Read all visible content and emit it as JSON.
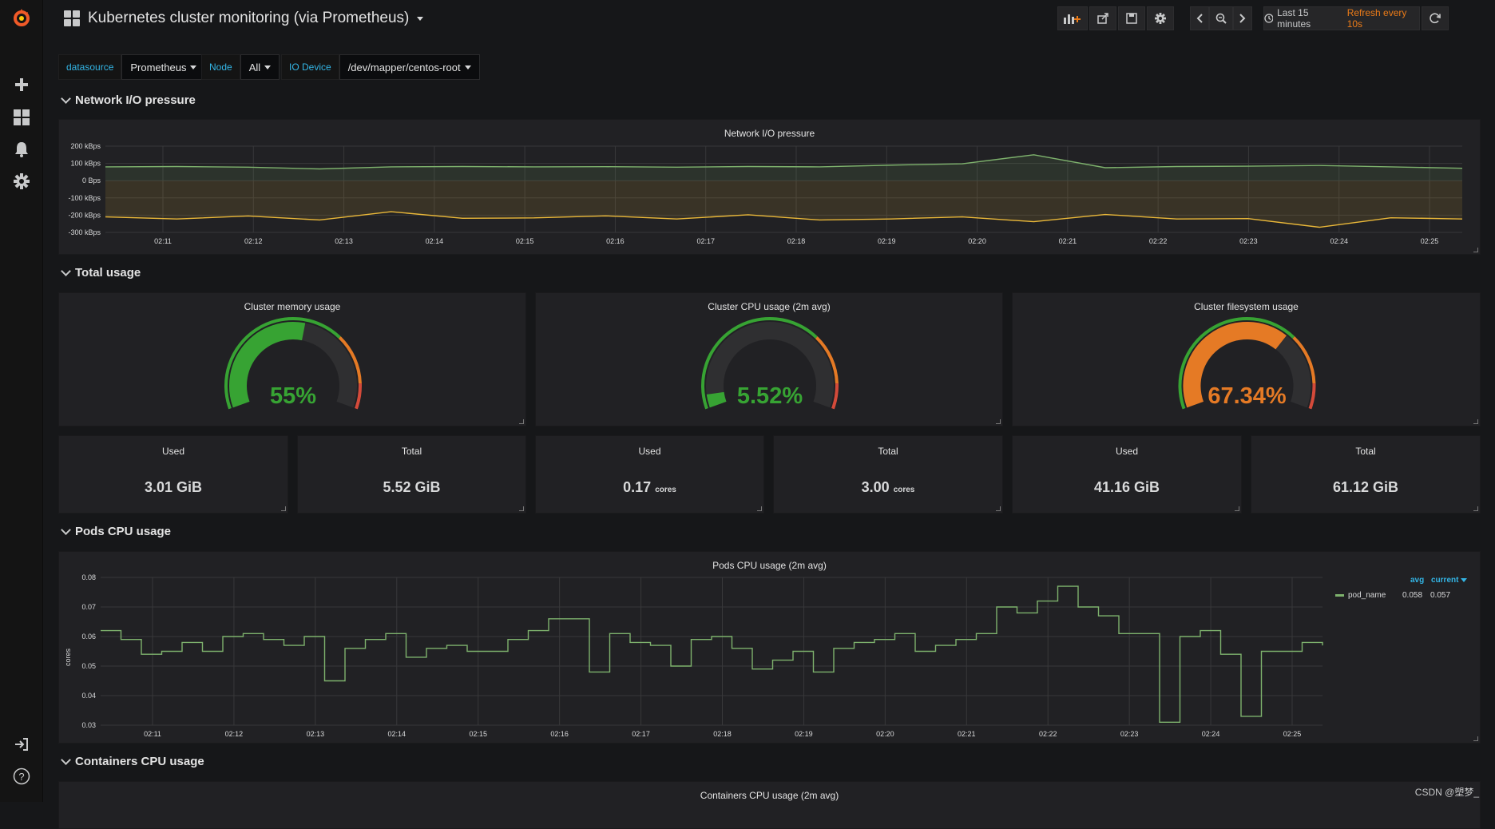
{
  "dashboard": {
    "title": "Kubernetes cluster monitoring (via Prometheus)"
  },
  "toolbar": {
    "time_range": "Last 15 minutes",
    "refresh": "Refresh every 10s",
    "icons": [
      "add-panel-icon",
      "share-icon",
      "save-icon",
      "settings-icon",
      "time-back-icon",
      "zoom-out-icon",
      "time-forward-icon",
      "clock-icon",
      "refresh-icon"
    ]
  },
  "sidebar": {
    "icons": [
      "grafana-logo-icon",
      "plus-icon",
      "dashboards-icon",
      "alerting-bell-icon",
      "configuration-gear-icon",
      "sign-in-icon",
      "help-icon"
    ]
  },
  "variables": [
    {
      "label": "datasource",
      "value": "Prometheus"
    },
    {
      "label": "Node",
      "value": "All"
    },
    {
      "label": "IO Device",
      "value": "/dev/mapper/centos-root"
    }
  ],
  "rows": {
    "network": "Network I/O pressure",
    "total": "Total usage",
    "pods": "Pods CPU usage",
    "containers": "Containers CPU usage"
  },
  "network_panel": {
    "title": "Network I/O pressure"
  },
  "gauges": [
    {
      "title": "Cluster memory usage",
      "value": 55,
      "display": "55%",
      "color": "#37a333"
    },
    {
      "title": "Cluster CPU usage (2m avg)",
      "value": 5.52,
      "display": "5.52%",
      "color": "#37a333"
    },
    {
      "title": "Cluster filesystem usage",
      "value": 67.34,
      "display": "67.34%",
      "color": "#e57a25"
    }
  ],
  "stats": [
    {
      "label": "Used",
      "value": "3.01 GiB",
      "unit": ""
    },
    {
      "label": "Total",
      "value": "5.52 GiB",
      "unit": ""
    },
    {
      "label": "Used",
      "value": "0.17",
      "unit": "cores"
    },
    {
      "label": "Total",
      "value": "3.00",
      "unit": "cores"
    },
    {
      "label": "Used",
      "value": "41.16 GiB",
      "unit": ""
    },
    {
      "label": "Total",
      "value": "61.12 GiB",
      "unit": ""
    }
  ],
  "pods_panel": {
    "title": "Pods CPU usage (2m avg)",
    "legend": {
      "avg_header": "avg",
      "current_header": "current",
      "series": "pod_name",
      "avg": "0.058",
      "current": "0.057"
    }
  },
  "containers_panel": {
    "title": "Containers CPU usage (2m avg)"
  },
  "watermark": "CSDN @塑梦_",
  "colors": {
    "green_series": "#7eb26d",
    "yellow_series": "#eab839",
    "accent_link": "#33b5e5",
    "refresh_orange": "#eb7b18"
  },
  "chart_data": [
    {
      "type": "line",
      "title": "Network I/O pressure",
      "x": [
        "02:11",
        "02:12",
        "02:13",
        "02:14",
        "02:15",
        "02:16",
        "02:17",
        "02:18",
        "02:19",
        "02:20",
        "02:21",
        "02:22",
        "02:23",
        "02:24",
        "02:25"
      ],
      "y_ticks": [
        "200 kBps",
        "100 kBps",
        "0 Bps",
        "-100 kBps",
        "-200 kBps",
        "-300 kBps"
      ],
      "ylim": [
        -300,
        200
      ],
      "unit": "kBps",
      "series": [
        {
          "color": "#7eb26d",
          "values": [
            80,
            82,
            78,
            68,
            80,
            82,
            80,
            81,
            78,
            82,
            80,
            90,
            98,
            150,
            75,
            82,
            84,
            88,
            80,
            72
          ]
        },
        {
          "color": "#eab839",
          "values": [
            -210,
            -222,
            -205,
            -228,
            -180,
            -218,
            -216,
            -204,
            -222,
            -198,
            -228,
            -222,
            -210,
            -238,
            -196,
            -222,
            -220,
            -270,
            -215,
            -222
          ]
        }
      ]
    },
    {
      "type": "line",
      "title": "Pods CPU usage (2m avg)",
      "ylabel": "cores",
      "x": [
        "02:11",
        "02:12",
        "02:13",
        "02:14",
        "02:15",
        "02:16",
        "02:17",
        "02:18",
        "02:19",
        "02:20",
        "02:21",
        "02:22",
        "02:23",
        "02:24",
        "02:25"
      ],
      "y_ticks": [
        "0.08",
        "0.07",
        "0.06",
        "0.05",
        "0.04",
        "0.03"
      ],
      "ylim": [
        0.03,
        0.08
      ],
      "series": [
        {
          "name": "pod_name",
          "color": "#7eb26d",
          "values": [
            0.062,
            0.059,
            0.054,
            0.055,
            0.058,
            0.055,
            0.06,
            0.061,
            0.059,
            0.057,
            0.06,
            0.045,
            0.056,
            0.059,
            0.061,
            0.053,
            0.056,
            0.057,
            0.055,
            0.055,
            0.059,
            0.062,
            0.066,
            0.066,
            0.048,
            0.061,
            0.058,
            0.057,
            0.05,
            0.059,
            0.06,
            0.056,
            0.049,
            0.052,
            0.055,
            0.048,
            0.056,
            0.058,
            0.059,
            0.061,
            0.055,
            0.057,
            0.059,
            0.061,
            0.07,
            0.068,
            0.072,
            0.077,
            0.07,
            0.067,
            0.061,
            0.061,
            0.031,
            0.06,
            0.062,
            0.054,
            0.033,
            0.055,
            0.055,
            0.058,
            0.057
          ]
        }
      ]
    }
  ]
}
